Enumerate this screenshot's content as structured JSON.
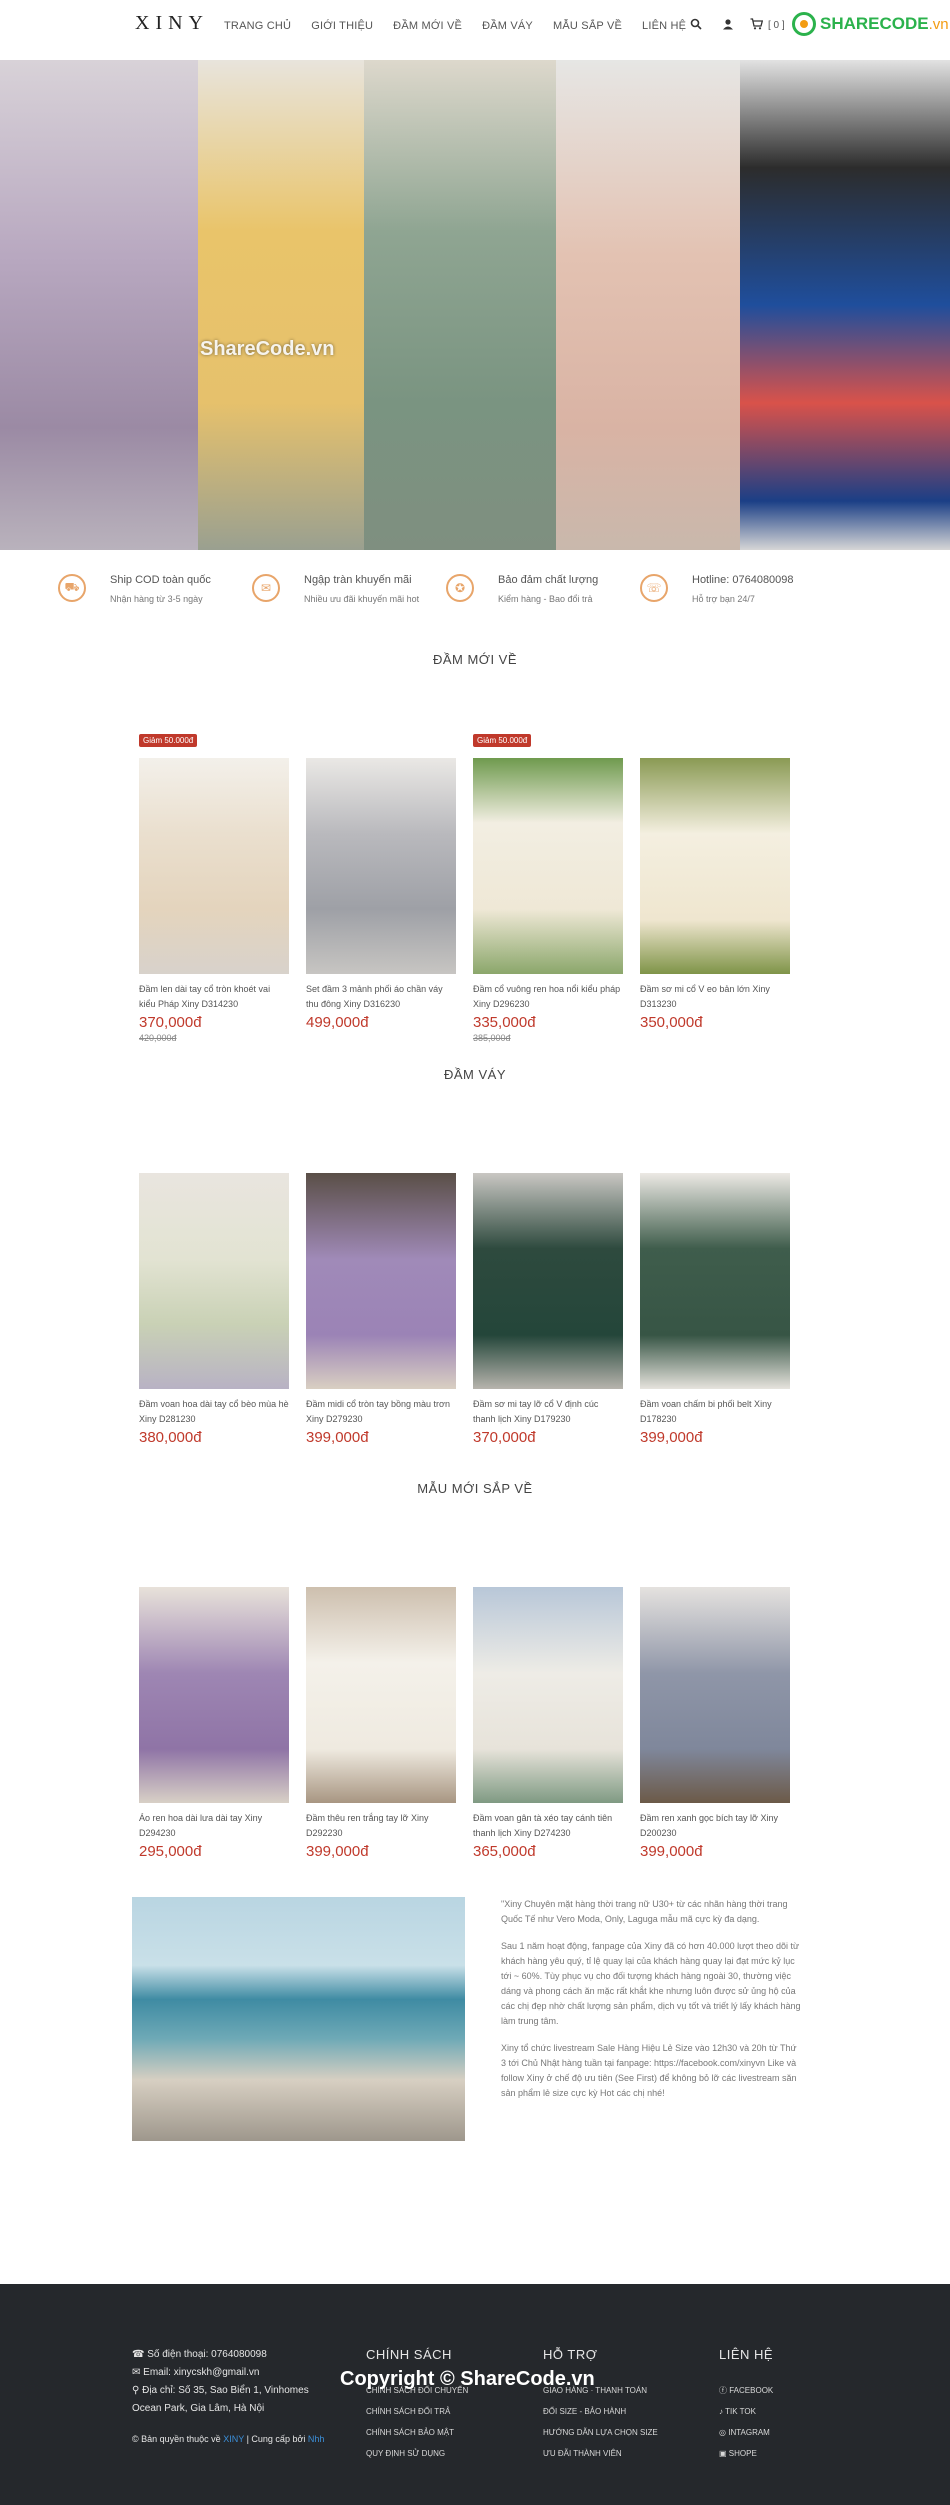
{
  "header": {
    "logo": "XINY",
    "nav": [
      "TRANG CHỦ",
      "GIỚI THIỆU",
      "ĐẦM MỚI VỀ",
      "ĐẦM VÁY",
      "MẪU SẮP VỀ",
      "LIÊN HỆ"
    ],
    "cart": "[ 0 ]",
    "brand": {
      "main": "SHARECODE",
      "suffix": ".vn"
    }
  },
  "hero": {
    "watermark": "ShareCode.vn"
  },
  "features": [
    {
      "icon": "truck-icon",
      "title": "Ship COD toàn quốc",
      "sub": "Nhận hàng từ 3-5 ngày"
    },
    {
      "icon": "gift-icon",
      "title": "Ngập tràn khuyến mãi",
      "sub": "Nhiều ưu đãi khuyến mãi hot"
    },
    {
      "icon": "badge-icon",
      "title": "Bảo đảm chất lượng",
      "sub": "Kiểm hàng - Bao đổi trả"
    },
    {
      "icon": "headset-icon",
      "title": "Hotline: 0764080098",
      "sub": "Hỗ trợ bạn 24/7"
    }
  ],
  "sections": {
    "new": {
      "title": "ĐẦM MỚI VỀ",
      "products": [
        {
          "sale": "Giảm 50.000đ",
          "name": "Đầm len dài tay cổ tròn khoét vai kiểu Pháp Xiny D314230",
          "price": "370,000đ",
          "old": "420,000đ"
        },
        {
          "sale": "",
          "name": "Set đầm 3 mảnh phối áo chần váy thu đông Xiny D316230",
          "price": "499,000đ",
          "old": ""
        },
        {
          "sale": "Giảm 50.000đ",
          "name": "Đầm cổ vuông ren hoa nổi kiểu pháp Xiny D296230",
          "price": "335,000đ",
          "old": "385,000đ"
        },
        {
          "sale": "",
          "name": "Đầm sơ mi cổ V eo bản lớn Xiny D313230",
          "price": "350,000đ",
          "old": ""
        }
      ]
    },
    "dress": {
      "title": "ĐẦM VÁY",
      "products": [
        {
          "name": "Đầm voan hoa dài tay cổ bèo mùa hè Xiny D281230",
          "price": "380,000đ"
        },
        {
          "name": "Đầm midi cổ tròn tay bồng màu trơn Xiny D279230",
          "price": "399,000đ"
        },
        {
          "name": "Đầm sơ mi tay lỡ cổ V định cúc thanh lịch Xiny D179230",
          "price": "370,000đ"
        },
        {
          "name": "Đầm voan chấm bi phối belt Xiny D178230",
          "price": "399,000đ"
        }
      ]
    },
    "upcoming": {
      "title": "MẪU MỚI SẮP VỀ",
      "products": [
        {
          "name": "Áo ren hoa dài lưa dài tay Xiny D294230",
          "price": "295,000đ"
        },
        {
          "name": "Đầm thêu ren trắng tay lỡ Xiny D292230",
          "price": "399,000đ"
        },
        {
          "name": "Đầm voan gân tà xéo tay cánh tiên thanh lịch Xiny D274230",
          "price": "365,000đ"
        },
        {
          "name": "Đầm ren xanh gọc bích tay lỡ Xiny D200230",
          "price": "399,000đ"
        }
      ]
    }
  },
  "about": {
    "p1": "\"Xiny Chuyên mặt hàng thời trang nữ U30+ từ các nhãn hàng thời trang Quốc Tế như Vero Moda, Only, Laguga mẫu mã cực kỳ đa dạng.",
    "p2": "Sau 1 năm hoạt động, fanpage của Xiny đã có hơn 40.000 lượt theo dõi từ khách hàng yêu quý, tỉ lệ quay lại của khách hàng quay lại đạt mức kỷ lục tới ~ 60%. Tùy phục vụ cho đối tượng khách hàng ngoài 30, thường việc dáng và phong cách ăn mặc rất khắt khe nhưng luôn được sử ủng hộ của các chị đẹp nhờ chất lượng sản phẩm, dịch vụ tốt và triết lý lấy khách hàng làm trung tâm.",
    "p3": "Xiny tổ chức livestream Sale Hàng Hiệu Lẻ Size vào 12h30 và 20h từ Thứ 3 tới Chủ Nhật hàng tuần tại fanpage: https://facebook.com/xinyvn Like và follow Xiny ở chế độ ưu tiên (See First) để không bỏ lỡ các livestream săn sản phẩm lẻ size cực kỳ Hot các chị nhé!"
  },
  "footer": {
    "phone": "Số điện thoại: 0764080098",
    "email": "Email: xinycskh@gmail.vn",
    "address": "Địa chỉ: Số 35, Sao Biển 1, Vinhomes Ocean Park, Gia Lâm, Hà Nội",
    "copy_pre": "© Bản quyền thuộc về",
    "copy_brand": "XINY",
    "copy_mid": "| Cung cấp bởi",
    "copy_provider": "Nhh",
    "col1": {
      "title": "CHÍNH SÁCH",
      "links": [
        "CHÍNH SÁCH ĐỔI CHUYỂN",
        "CHÍNH SÁCH ĐỔI TRẢ",
        "CHÍNH SÁCH BẢO MẬT",
        "QUY ĐỊNH SỬ DỤNG"
      ]
    },
    "col2": {
      "title": "HỖ TRỢ",
      "links": [
        "GIAO HÀNG · THANH TOÁN",
        "ĐỔI SIZE - BẢO HÀNH",
        "HƯỚNG DẪN LỰA CHỌN SIZE",
        "ƯU ĐÃI THÀNH VIÊN"
      ]
    },
    "col3": {
      "title": "LIÊN HỆ",
      "links": [
        "FACEBOOK",
        "TIK TOK",
        "INTAGRAM",
        "SHOPE"
      ]
    },
    "watermark": "Copyright © ShareCode.vn"
  }
}
